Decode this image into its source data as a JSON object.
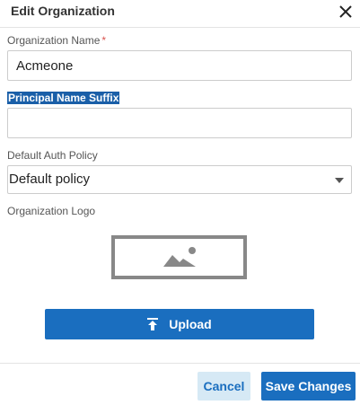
{
  "dialog": {
    "title": "Edit Organization"
  },
  "form": {
    "org_name": {
      "label": "Organization Name",
      "required_mark": "*",
      "value": "Acmeone"
    },
    "principal_suffix": {
      "label": "Principal Name Suffix",
      "value": ""
    },
    "auth_policy": {
      "label": "Default Auth Policy",
      "selected": "Default policy"
    },
    "logo": {
      "label": "Organization Logo",
      "placeholder_icon": "image-placeholder-icon"
    }
  },
  "upload_button": {
    "label": "Upload",
    "icon": "upload-icon"
  },
  "footer": {
    "cancel_label": "Cancel",
    "save_label": "Save Changes"
  },
  "colors": {
    "primary": "#1a6ebf",
    "cancel_bg": "#d6e9f5",
    "required": "#d9534f",
    "highlight": "#1a5fa8"
  }
}
